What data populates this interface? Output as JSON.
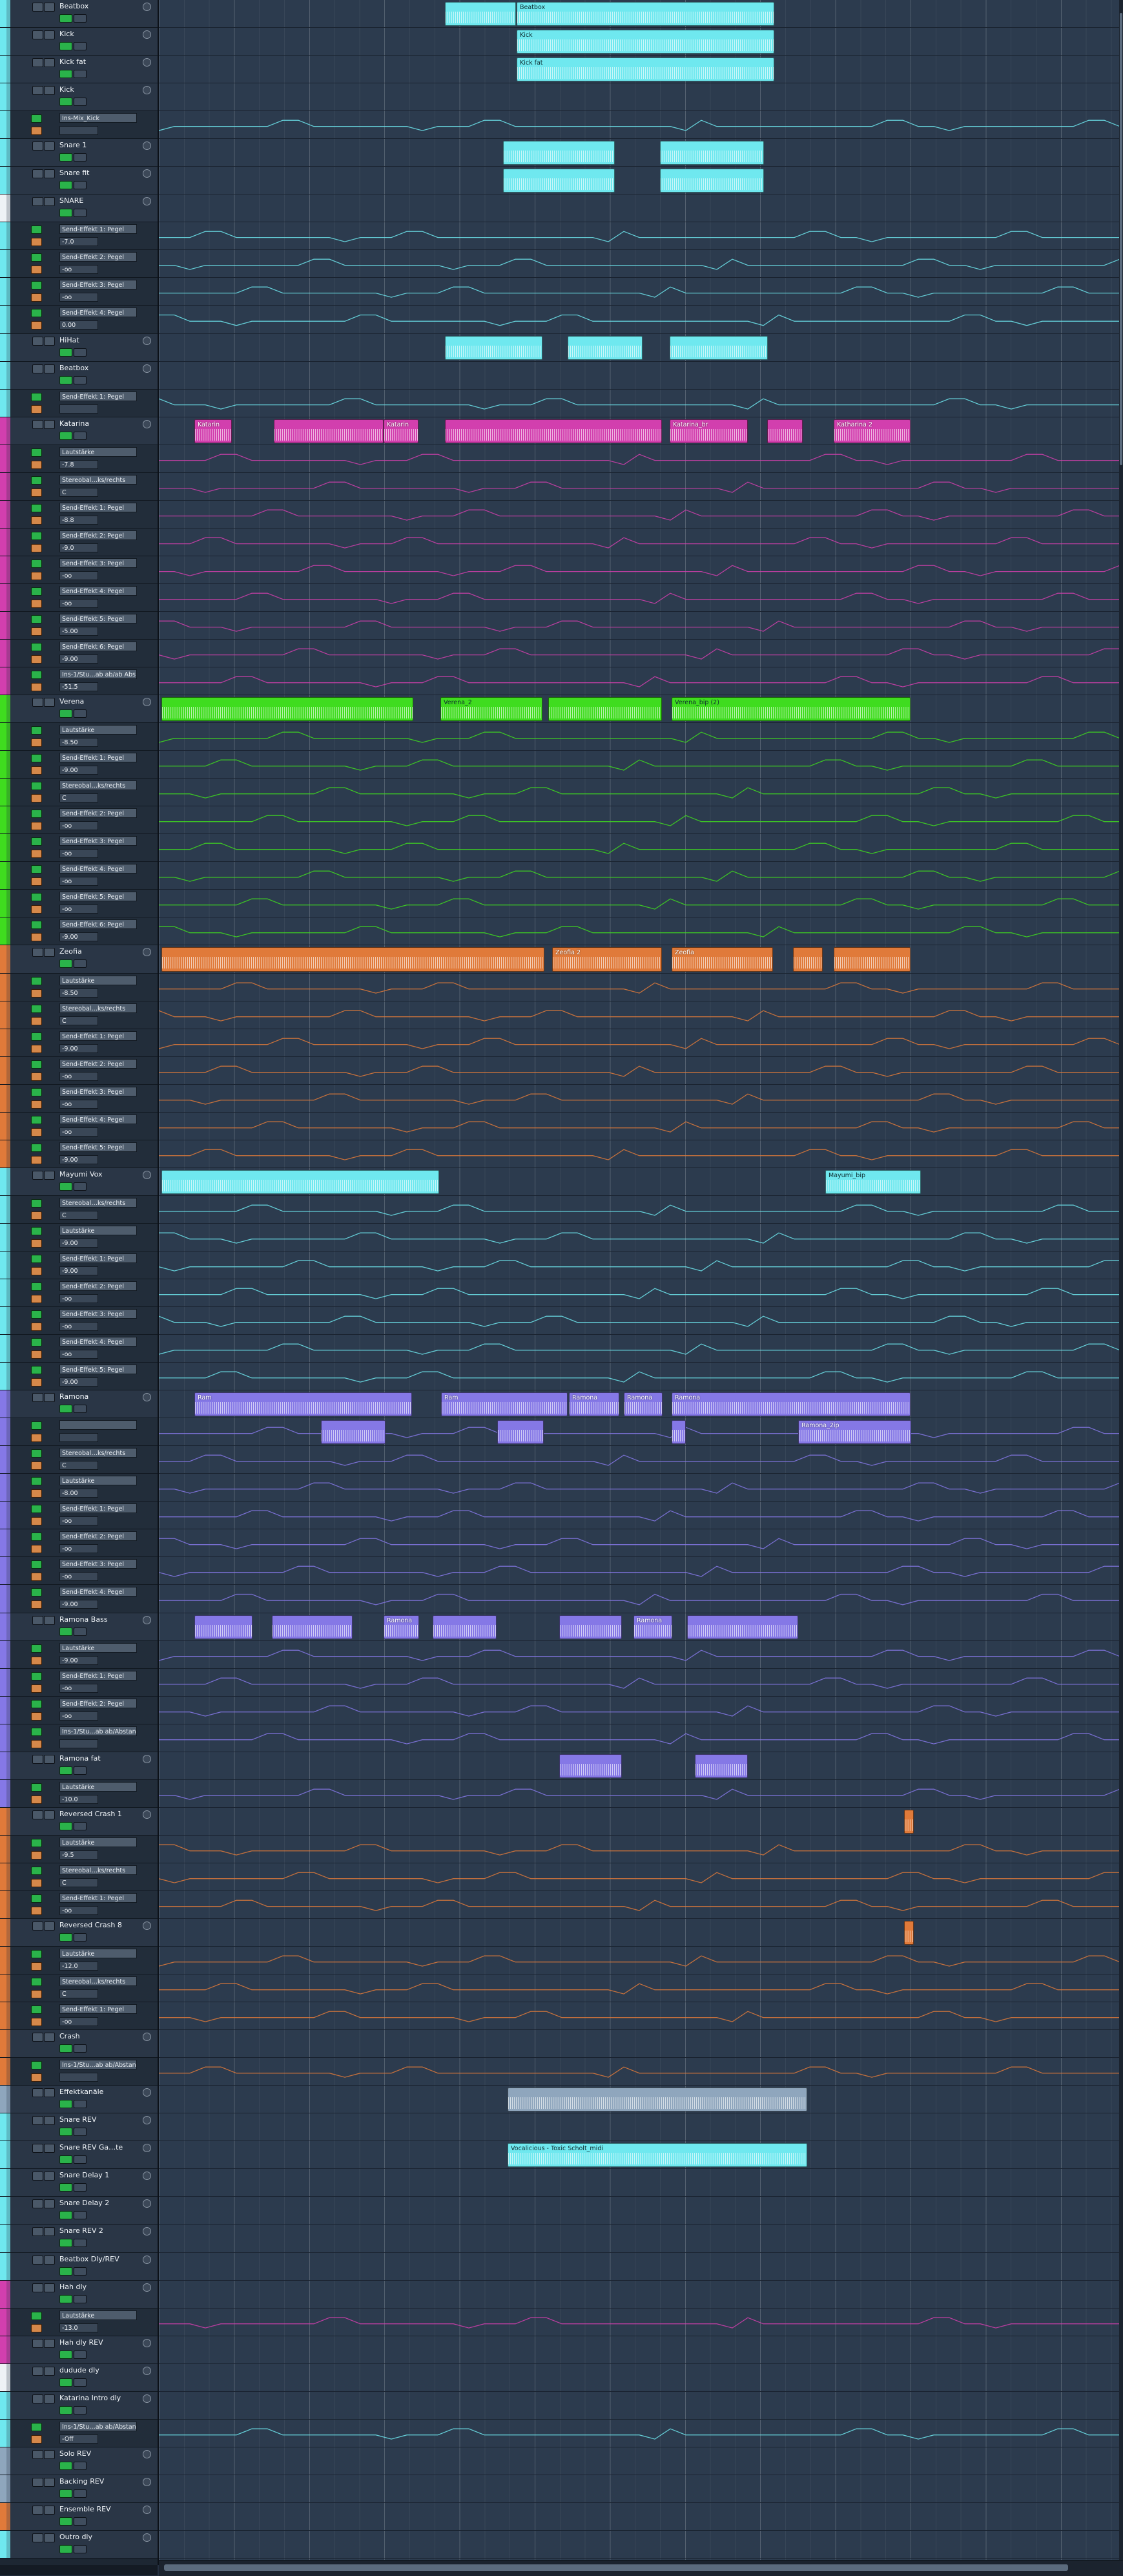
{
  "app": {
    "name": "Arrangement"
  },
  "colors": {
    "cyan": "#6fe8ef",
    "magenta": "#d23fae",
    "green": "#3fdc1f",
    "orange": "#e07a3a",
    "purple": "#8578e6",
    "slate": "#8fa6bd",
    "white": "#eef2f6"
  },
  "tracks": [
    {
      "kind": "header",
      "name": "Beatbox",
      "color": "cyan"
    },
    {
      "kind": "header",
      "name": "Kick",
      "color": "cyan"
    },
    {
      "kind": "header",
      "name": "Kick fat",
      "color": "cyan"
    },
    {
      "kind": "header",
      "name": "Kick",
      "color": "cyan"
    },
    {
      "kind": "auto",
      "param": "Ins-Mix_Kick",
      "value": "",
      "color": "cyan"
    },
    {
      "kind": "header",
      "name": "Snare 1",
      "color": "cyan"
    },
    {
      "kind": "header",
      "name": "Snare fit",
      "color": "cyan"
    },
    {
      "kind": "header",
      "name": "SNARE",
      "color": "white"
    },
    {
      "kind": "auto",
      "param": "Send-Effekt 1: Pegel",
      "value": "-7.0",
      "color": "cyan"
    },
    {
      "kind": "auto",
      "param": "Send-Effekt 2: Pegel",
      "value": "-oo",
      "color": "cyan"
    },
    {
      "kind": "auto",
      "param": "Send-Effekt 3: Pegel",
      "value": "-oo",
      "color": "cyan"
    },
    {
      "kind": "auto",
      "param": "Send-Effekt 4: Pegel",
      "value": "0.00",
      "color": "cyan"
    },
    {
      "kind": "header",
      "name": "HiHat",
      "color": "cyan"
    },
    {
      "kind": "header",
      "name": "Beatbox",
      "color": "cyan"
    },
    {
      "kind": "auto",
      "param": "Send-Effekt 1: Pegel",
      "value": "",
      "color": "cyan"
    },
    {
      "kind": "header",
      "name": "Katarina",
      "color": "magenta"
    },
    {
      "kind": "auto",
      "param": "Lautstärke",
      "value": "-7.8",
      "color": "magenta"
    },
    {
      "kind": "auto",
      "param": "Stereobal…ks/rechts",
      "value": "C",
      "color": "magenta"
    },
    {
      "kind": "auto",
      "param": "Send-Effekt 1: Pegel",
      "value": "-8.8",
      "color": "magenta"
    },
    {
      "kind": "auto",
      "param": "Send-Effekt 2: Pegel",
      "value": "-9.0",
      "color": "magenta"
    },
    {
      "kind": "auto",
      "param": "Send-Effekt 3: Pegel",
      "value": "-oo",
      "color": "magenta"
    },
    {
      "kind": "auto",
      "param": "Send-Effekt 4: Pegel",
      "value": "-oo",
      "color": "magenta"
    },
    {
      "kind": "auto",
      "param": "Send-Effekt 5: Pegel",
      "value": "-5.00",
      "color": "magenta"
    },
    {
      "kind": "auto",
      "param": "Send-Effekt 6: Pegel",
      "value": "-9.00",
      "color": "magenta"
    },
    {
      "kind": "auto",
      "param": "Ins-1/Stu…ab ab/ab Abs",
      "value": "-51.5",
      "color": "magenta"
    },
    {
      "kind": "header",
      "name": "Verena",
      "color": "green"
    },
    {
      "kind": "auto",
      "param": "Lautstärke",
      "value": "-8.50",
      "color": "green"
    },
    {
      "kind": "auto",
      "param": "Send-Effekt 1: Pegel",
      "value": "-9.00",
      "color": "green"
    },
    {
      "kind": "auto",
      "param": "Stereobal…ks/rechts",
      "value": "C",
      "color": "green"
    },
    {
      "kind": "auto",
      "param": "Send-Effekt 2: Pegel",
      "value": "-oo",
      "color": "green"
    },
    {
      "kind": "auto",
      "param": "Send-Effekt 3: Pegel",
      "value": "-oo",
      "color": "green"
    },
    {
      "kind": "auto",
      "param": "Send-Effekt 4: Pegel",
      "value": "-oo",
      "color": "green"
    },
    {
      "kind": "auto",
      "param": "Send-Effekt 5: Pegel",
      "value": "-oo",
      "color": "green"
    },
    {
      "kind": "auto",
      "param": "Send-Effekt 6: Pegel",
      "value": "-9.00",
      "color": "green"
    },
    {
      "kind": "header",
      "name": "Zeofia",
      "color": "orange"
    },
    {
      "kind": "auto",
      "param": "Lautstärke",
      "value": "-8.50",
      "color": "orange"
    },
    {
      "kind": "auto",
      "param": "Stereobal…ks/rechts",
      "value": "C",
      "color": "orange"
    },
    {
      "kind": "auto",
      "param": "Send-Effekt 1: Pegel",
      "value": "-9.00",
      "color": "orange"
    },
    {
      "kind": "auto",
      "param": "Send-Effekt 2: Pegel",
      "value": "-oo",
      "color": "orange"
    },
    {
      "kind": "auto",
      "param": "Send-Effekt 3: Pegel",
      "value": "-oo",
      "color": "orange"
    },
    {
      "kind": "auto",
      "param": "Send-Effekt 4: Pegel",
      "value": "-oo",
      "color": "orange"
    },
    {
      "kind": "auto",
      "param": "Send-Effekt 5: Pegel",
      "value": "-9.00",
      "color": "orange"
    },
    {
      "kind": "header",
      "name": "Mayumi Vox",
      "color": "cyan"
    },
    {
      "kind": "auto",
      "param": "Stereobal…ks/rechts",
      "value": "C",
      "color": "cyan"
    },
    {
      "kind": "auto",
      "param": "Lautstärke",
      "value": "-9.00",
      "color": "cyan"
    },
    {
      "kind": "auto",
      "param": "Send-Effekt 1: Pegel",
      "value": "-9.00",
      "color": "cyan"
    },
    {
      "kind": "auto",
      "param": "Send-Effekt 2: Pegel",
      "value": "-oo",
      "color": "cyan"
    },
    {
      "kind": "auto",
      "param": "Send-Effekt 3: Pegel",
      "value": "-oo",
      "color": "cyan"
    },
    {
      "kind": "auto",
      "param": "Send-Effekt 4: Pegel",
      "value": "-oo",
      "color": "cyan"
    },
    {
      "kind": "auto",
      "param": "Send-Effekt 5: Pegel",
      "value": "-9.00",
      "color": "cyan"
    },
    {
      "kind": "header",
      "name": "Ramona",
      "color": "purple"
    },
    {
      "kind": "auto",
      "param": "",
      "value": "",
      "color": "purple"
    },
    {
      "kind": "auto",
      "param": "Stereobal…ks/rechts",
      "value": "C",
      "color": "purple"
    },
    {
      "kind": "auto",
      "param": "Lautstärke",
      "value": "-8.00",
      "color": "purple"
    },
    {
      "kind": "auto",
      "param": "Send-Effekt 1: Pegel",
      "value": "-oo",
      "color": "purple"
    },
    {
      "kind": "auto",
      "param": "Send-Effekt 2: Pegel",
      "value": "-oo",
      "color": "purple"
    },
    {
      "kind": "auto",
      "param": "Send-Effekt 3: Pegel",
      "value": "-oo",
      "color": "purple"
    },
    {
      "kind": "auto",
      "param": "Send-Effekt 4: Pegel",
      "value": "-9.00",
      "color": "purple"
    },
    {
      "kind": "header",
      "name": "Ramona Bass",
      "color": "purple"
    },
    {
      "kind": "auto",
      "param": "Lautstärke",
      "value": "-9.00",
      "color": "purple"
    },
    {
      "kind": "auto",
      "param": "Send-Effekt 1: Pegel",
      "value": "-oo",
      "color": "purple"
    },
    {
      "kind": "auto",
      "param": "Send-Effekt 2: Pegel",
      "value": "-oo",
      "color": "purple"
    },
    {
      "kind": "auto",
      "param": "Ins-1/Stu…ab ab/Abstand",
      "value": "",
      "color": "purple"
    },
    {
      "kind": "header",
      "name": "Ramona fat",
      "color": "purple"
    },
    {
      "kind": "auto",
      "param": "Lautstärke",
      "value": "-10.0",
      "color": "purple"
    },
    {
      "kind": "header",
      "name": "Reversed Crash 1",
      "color": "orange"
    },
    {
      "kind": "auto",
      "param": "Lautstärke",
      "value": "-9.5",
      "color": "orange"
    },
    {
      "kind": "auto",
      "param": "Stereobal…ks/rechts",
      "value": "C",
      "color": "orange"
    },
    {
      "kind": "auto",
      "param": "Send-Effekt 1: Pegel",
      "value": "-oo",
      "color": "orange"
    },
    {
      "kind": "header",
      "name": "Reversed Crash 8",
      "color": "orange"
    },
    {
      "kind": "auto",
      "param": "Lautstärke",
      "value": "-12.0",
      "color": "orange"
    },
    {
      "kind": "auto",
      "param": "Stereobal…ks/rechts",
      "value": "C",
      "color": "orange"
    },
    {
      "kind": "auto",
      "param": "Send-Effekt 1: Pegel",
      "value": "-oo",
      "color": "orange"
    },
    {
      "kind": "header",
      "name": "Crash",
      "color": "orange"
    },
    {
      "kind": "auto",
      "param": "Ins-1/Stu…ab ab/Abstand",
      "value": "",
      "color": "orange"
    },
    {
      "kind": "header",
      "name": "Effektkanäle",
      "color": "slate"
    },
    {
      "kind": "header",
      "name": "Snare REV",
      "color": "cyan"
    },
    {
      "kind": "header",
      "name": "Snare REV Ga…te",
      "color": "cyan"
    },
    {
      "kind": "header",
      "name": "Snare Delay 1",
      "color": "cyan"
    },
    {
      "kind": "header",
      "name": "Snare Delay 2",
      "color": "cyan"
    },
    {
      "kind": "header",
      "name": "Snare REV 2",
      "color": "cyan"
    },
    {
      "kind": "header",
      "name": "Beatbox Dly/REV",
      "color": "cyan"
    },
    {
      "kind": "header",
      "name": "Hah dly",
      "color": "magenta"
    },
    {
      "kind": "auto",
      "param": "Lautstärke",
      "value": "-13.0",
      "color": "magenta"
    },
    {
      "kind": "header",
      "name": "Hah dly REV",
      "color": "magenta"
    },
    {
      "kind": "header",
      "name": "dudude dly",
      "color": "white"
    },
    {
      "kind": "header",
      "name": "Katarina Intro dly",
      "color": "cyan"
    },
    {
      "kind": "auto",
      "param": "Ins-1/Stu…ab ab/Abstand",
      "value": "-Off",
      "color": "cyan"
    },
    {
      "kind": "header",
      "name": "Solo REV",
      "color": "slate"
    },
    {
      "kind": "header",
      "name": "Backing REV",
      "color": "slate"
    },
    {
      "kind": "header",
      "name": "Ensemble REV",
      "color": "orange"
    },
    {
      "kind": "header",
      "name": "Outro dly",
      "color": "cyan"
    }
  ],
  "clips": [
    {
      "lane": 0,
      "start": 0.297,
      "end": 0.371,
      "label": "",
      "color": "cyan"
    },
    {
      "lane": 0,
      "start": 0.371,
      "end": 0.638,
      "label": "Beatbox",
      "color": "cyan"
    },
    {
      "lane": 1,
      "start": 0.371,
      "end": 0.638,
      "label": "Kick",
      "color": "cyan"
    },
    {
      "lane": 2,
      "start": 0.371,
      "end": 0.638,
      "label": "Kick fat",
      "color": "cyan"
    },
    {
      "lane": 5,
      "start": 0.357,
      "end": 0.473,
      "label": "",
      "color": "cyan"
    },
    {
      "lane": 5,
      "start": 0.52,
      "end": 0.628,
      "label": "",
      "color": "cyan"
    },
    {
      "lane": 6,
      "start": 0.357,
      "end": 0.473,
      "label": "",
      "color": "cyan"
    },
    {
      "lane": 6,
      "start": 0.52,
      "end": 0.628,
      "label": "",
      "color": "cyan"
    },
    {
      "lane": 12,
      "start": 0.297,
      "end": 0.398,
      "label": "",
      "color": "cyan"
    },
    {
      "lane": 12,
      "start": 0.424,
      "end": 0.502,
      "label": "",
      "color": "cyan"
    },
    {
      "lane": 12,
      "start": 0.53,
      "end": 0.632,
      "label": "",
      "color": "cyan"
    },
    {
      "lane": 15,
      "start": 0.037,
      "end": 0.076,
      "label": "Katarin",
      "color": "magenta"
    },
    {
      "lane": 15,
      "start": 0.119,
      "end": 0.233,
      "label": "",
      "color": "magenta"
    },
    {
      "lane": 15,
      "start": 0.233,
      "end": 0.269,
      "label": "Katarin",
      "color": "magenta"
    },
    {
      "lane": 15,
      "start": 0.297,
      "end": 0.522,
      "label": "",
      "color": "magenta"
    },
    {
      "lane": 15,
      "start": 0.53,
      "end": 0.611,
      "label": "Katarina_br",
      "color": "magenta"
    },
    {
      "lane": 15,
      "start": 0.631,
      "end": 0.668,
      "label": "",
      "color": "magenta"
    },
    {
      "lane": 15,
      "start": 0.7,
      "end": 0.78,
      "label": "Katharina 2",
      "color": "magenta"
    },
    {
      "lane": 25,
      "start": 0.003,
      "end": 0.264,
      "label": "",
      "color": "green"
    },
    {
      "lane": 25,
      "start": 0.292,
      "end": 0.398,
      "label": "Verena_2",
      "color": "green"
    },
    {
      "lane": 25,
      "start": 0.404,
      "end": 0.522,
      "label": "",
      "color": "green"
    },
    {
      "lane": 25,
      "start": 0.532,
      "end": 0.78,
      "label": "Verena_bip (2)",
      "color": "green"
    },
    {
      "lane": 34,
      "start": 0.003,
      "end": 0.4,
      "label": "",
      "color": "orange"
    },
    {
      "lane": 34,
      "start": 0.408,
      "end": 0.522,
      "label": "Zeofia 2",
      "color": "orange"
    },
    {
      "lane": 34,
      "start": 0.532,
      "end": 0.637,
      "label": "Zeofia",
      "color": "orange"
    },
    {
      "lane": 34,
      "start": 0.658,
      "end": 0.689,
      "label": "",
      "color": "orange"
    },
    {
      "lane": 34,
      "start": 0.7,
      "end": 0.78,
      "label": "",
      "color": "orange"
    },
    {
      "lane": 42,
      "start": 0.003,
      "end": 0.291,
      "label": "",
      "color": "cyan"
    },
    {
      "lane": 42,
      "start": 0.691,
      "end": 0.79,
      "label": "Mayumi_bip",
      "color": "cyan"
    },
    {
      "lane": 50,
      "start": 0.037,
      "end": 0.263,
      "label": "Ram",
      "color": "purple"
    },
    {
      "lane": 50,
      "start": 0.293,
      "end": 0.424,
      "label": "Ram",
      "color": "purple"
    },
    {
      "lane": 50,
      "start": 0.425,
      "end": 0.477,
      "label": "Ramona",
      "color": "purple"
    },
    {
      "lane": 50,
      "start": 0.482,
      "end": 0.522,
      "label": "Ramona",
      "color": "purple"
    },
    {
      "lane": 50,
      "start": 0.532,
      "end": 0.78,
      "label": "Ramona",
      "color": "purple"
    },
    {
      "lane": 51,
      "start": 0.168,
      "end": 0.235,
      "label": "",
      "color": "purple"
    },
    {
      "lane": 51,
      "start": 0.351,
      "end": 0.399,
      "label": "",
      "color": "purple"
    },
    {
      "lane": 51,
      "start": 0.532,
      "end": 0.547,
      "label": "",
      "color": "purple"
    },
    {
      "lane": 51,
      "start": 0.663,
      "end": 0.78,
      "label": "Ramona_2ip",
      "color": "purple"
    },
    {
      "lane": 58,
      "start": 0.037,
      "end": 0.097,
      "label": "",
      "color": "purple"
    },
    {
      "lane": 58,
      "start": 0.117,
      "end": 0.201,
      "label": "",
      "color": "purple"
    },
    {
      "lane": 58,
      "start": 0.233,
      "end": 0.27,
      "label": "Ramona",
      "color": "purple"
    },
    {
      "lane": 58,
      "start": 0.284,
      "end": 0.35,
      "label": "",
      "color": "purple"
    },
    {
      "lane": 58,
      "start": 0.415,
      "end": 0.48,
      "label": "",
      "color": "purple"
    },
    {
      "lane": 58,
      "start": 0.492,
      "end": 0.532,
      "label": "Ramona",
      "color": "purple"
    },
    {
      "lane": 58,
      "start": 0.548,
      "end": 0.663,
      "label": "",
      "color": "purple"
    },
    {
      "lane": 63,
      "start": 0.415,
      "end": 0.48,
      "label": "",
      "color": "purple"
    },
    {
      "lane": 63,
      "start": 0.556,
      "end": 0.611,
      "label": "",
      "color": "purple"
    },
    {
      "lane": 65,
      "start": 0.773,
      "end": 0.783,
      "label": "",
      "color": "orange"
    },
    {
      "lane": 69,
      "start": 0.773,
      "end": 0.783,
      "label": "",
      "color": "orange"
    },
    {
      "lane": 75,
      "start": 0.362,
      "end": 0.673,
      "label": "",
      "color": "slate"
    },
    {
      "lane": 77,
      "start": 0.362,
      "end": 0.673,
      "label": "Vocalicious - Toxic Scholt_midi",
      "color": "cyan"
    }
  ]
}
